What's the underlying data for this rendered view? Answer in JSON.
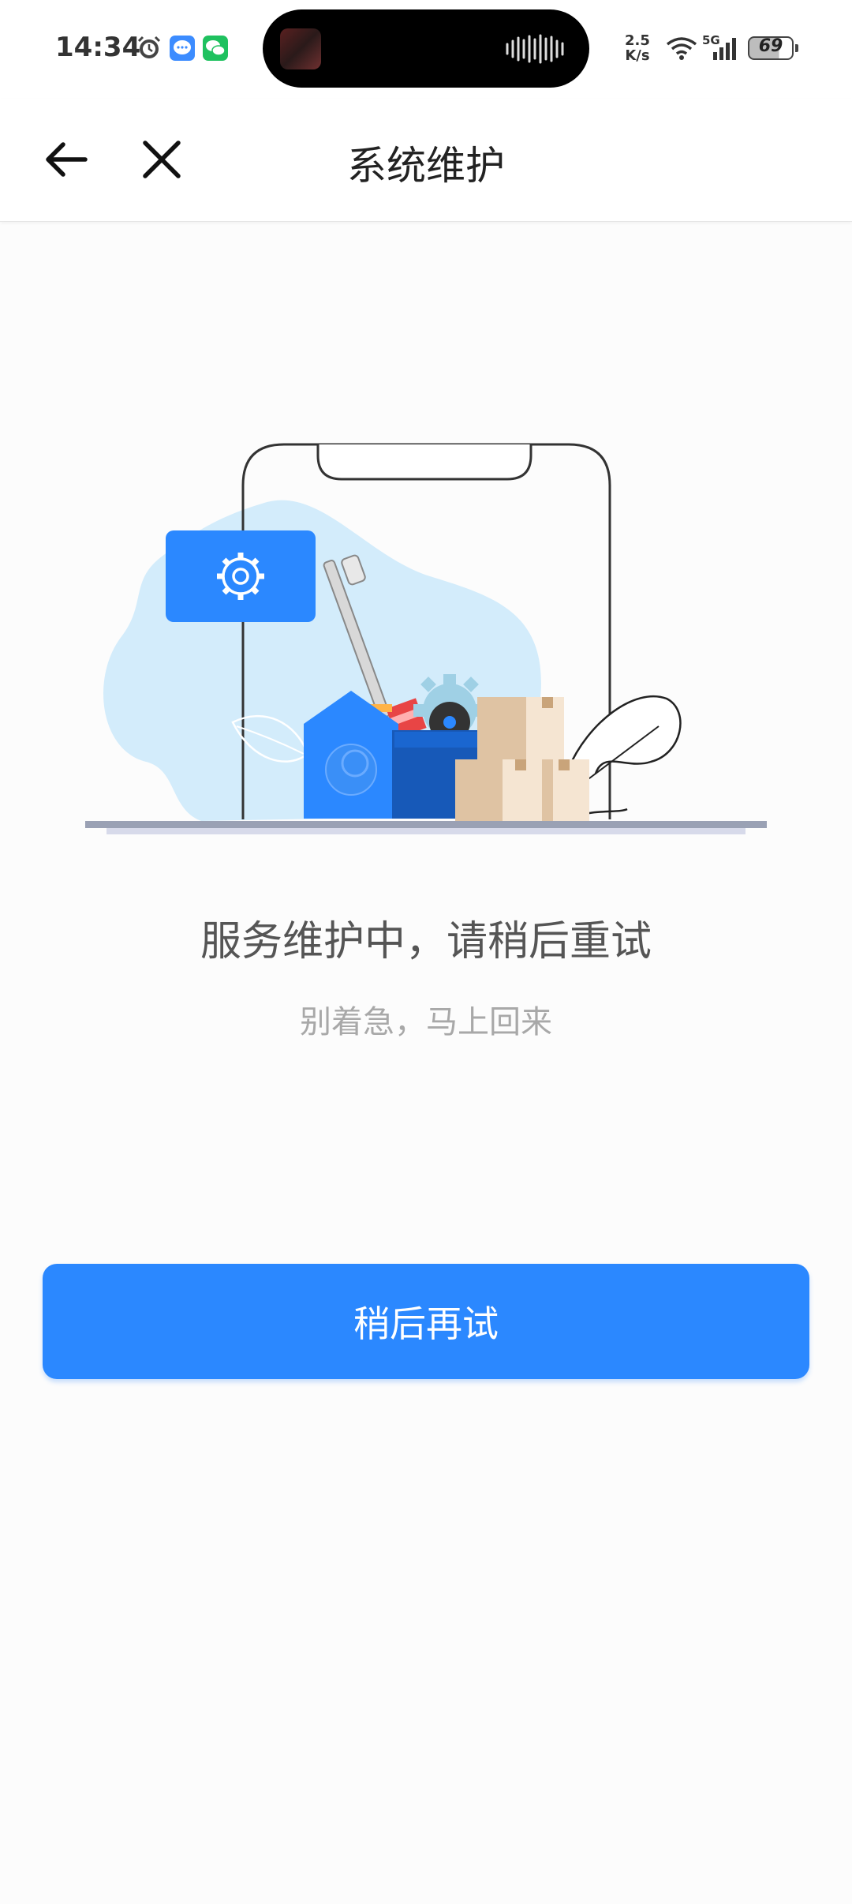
{
  "status_bar": {
    "time": "14:34",
    "net_speed_value": "2.5",
    "net_speed_unit": "K/s",
    "network": "5G",
    "battery": "69",
    "icons": [
      "alarm-icon",
      "message-icon",
      "wechat-icon",
      "wifi-icon",
      "signal-icon",
      "battery-icon"
    ]
  },
  "header": {
    "title": "系统维护",
    "back_icon": "back-arrow-icon",
    "close_icon": "close-icon"
  },
  "main": {
    "message": "服务维护中，请稍后重试",
    "sub_message": "别着急，马上回来",
    "illustration": "maintenance-illustration"
  },
  "actions": {
    "retry_label": "稍后再试"
  },
  "colors": {
    "primary": "#2b88ff",
    "background": "#fcfcfc",
    "light_blue": "#d4ecfb",
    "gear_blue": "#2f8cff"
  }
}
